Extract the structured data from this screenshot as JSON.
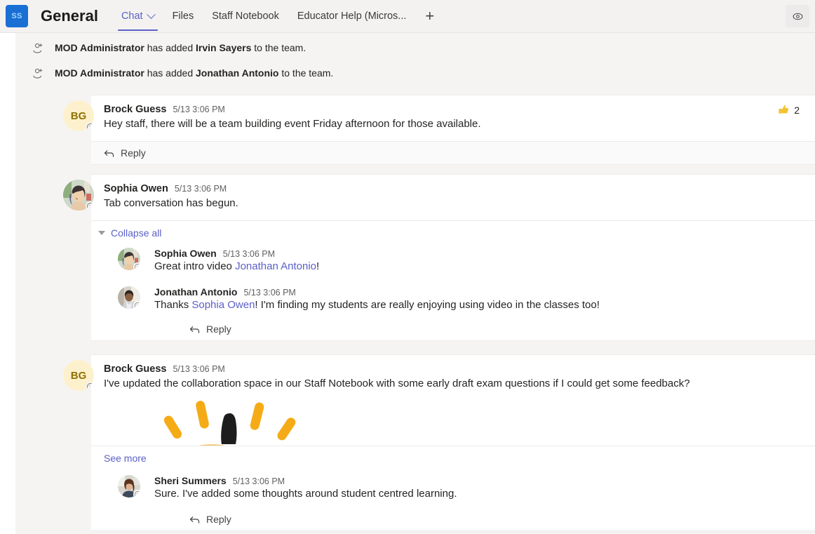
{
  "header": {
    "team_badge": "SS",
    "channel_title": "General",
    "tabs": [
      {
        "label": "Chat",
        "active": true,
        "has_chevron": true
      },
      {
        "label": "Files",
        "active": false,
        "has_chevron": false
      },
      {
        "label": "Staff Notebook",
        "active": false,
        "has_chevron": false
      },
      {
        "label": "Educator Help (Micros...",
        "active": false,
        "has_chevron": false
      }
    ],
    "add_tab_label": "+",
    "right_icon": "eye-icon",
    "accent_color": "#5b5fc7",
    "badge_color": "#1a6fd4"
  },
  "system_messages": [
    {
      "icon": "add-person-icon",
      "actor": "MOD Administrator",
      "middle": " has added ",
      "target": "Irvin Sayers",
      "tail": " to the team."
    },
    {
      "icon": "add-person-icon",
      "actor": "MOD Administrator",
      "middle": " has added ",
      "target": "Jonathan Antonio",
      "tail": " to the team."
    }
  ],
  "messages": {
    "brock_event": {
      "avatar_initials": "BG",
      "author": "Brock Guess",
      "time": "5/13 3:06 PM",
      "text": "Hey staff, there will be a team building event Friday afternoon for those available.",
      "reply_label": "Reply",
      "reaction": {
        "emoji": "thumbs-up-icon",
        "count": "2"
      }
    },
    "sophia_tab": {
      "author": "Sophia Owen",
      "time": "5/13 3:06 PM",
      "text": "Tab conversation has begun.",
      "collapse_label": "Collapse all",
      "reply_label": "Reply",
      "thread": [
        {
          "author": "Sophia Owen",
          "time": "5/13 3:06 PM",
          "text_before": "Great intro video ",
          "mention": "Jonathan Antonio",
          "text_after": "!"
        },
        {
          "author": "Jonathan Antonio",
          "time": "5/13 3:06 PM",
          "text_before": "Thanks ",
          "mention": "Sophia Owen",
          "text_after": "! I'm finding my students are really enjoying using video in the classes too!"
        }
      ]
    },
    "brock_notebook": {
      "avatar_initials": "BG",
      "author": "Brock Guess",
      "time": "5/13 3:06 PM",
      "text": "I've updated the collaboration space in our Staff Notebook with some early draft exam questions if I could get some feedback?",
      "media": "clapping-hands-gif",
      "see_more_label": "See more",
      "reply_label": "Reply",
      "thread": [
        {
          "author": "Sheri Summers",
          "time": "5/13 3:06 PM",
          "text_before": "Sure. I've added some thoughts around student centred learning.",
          "mention": "",
          "text_after": ""
        }
      ]
    }
  }
}
